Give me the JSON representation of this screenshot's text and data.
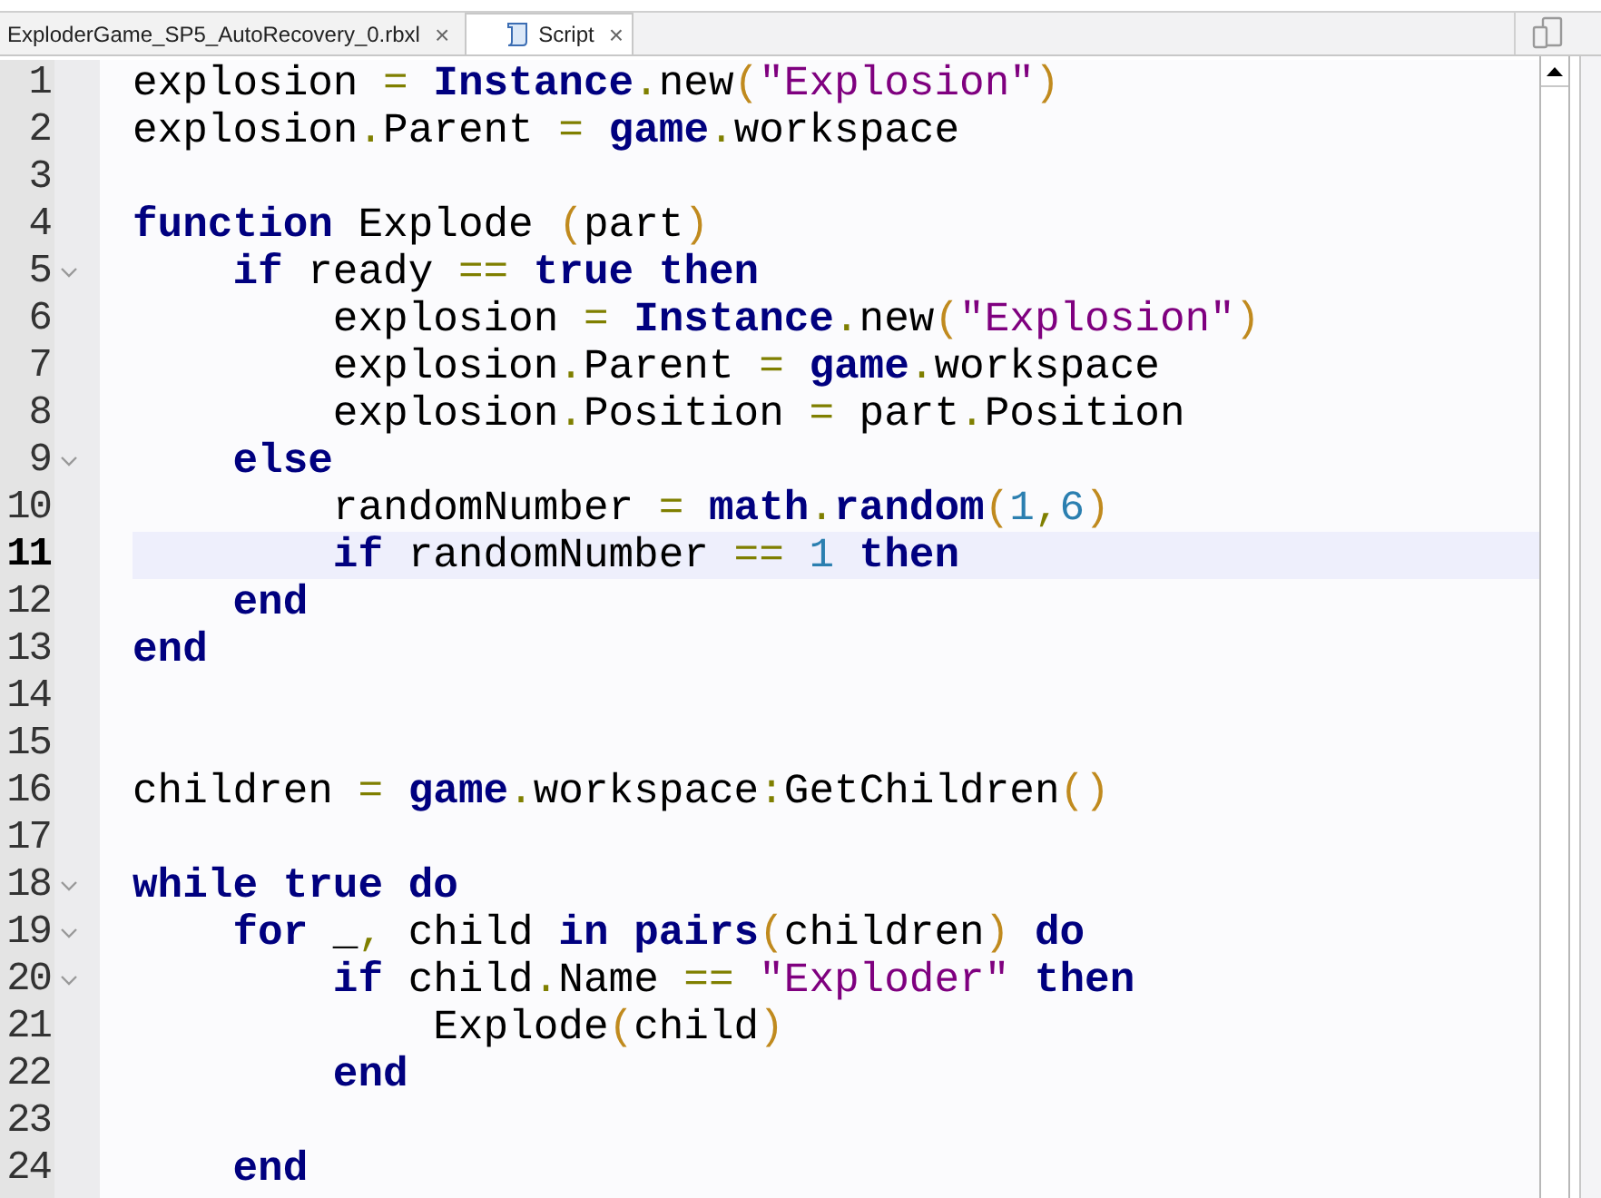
{
  "tabs": [
    {
      "label": "ExploderGame_SP5_AutoRecovery_0.rbxl",
      "selected": false,
      "kind": "place"
    },
    {
      "label": "Script",
      "selected": true,
      "kind": "script"
    }
  ],
  "close_glyph": "×",
  "editor": {
    "lines": [
      {
        "number": "1",
        "fold": false,
        "current": false,
        "tokens": [
          {
            "kind": "plain",
            "text": "explosion "
          },
          {
            "kind": "op",
            "text": "= "
          },
          {
            "kind": "kw",
            "text": "Instance"
          },
          {
            "kind": "op",
            "text": "."
          },
          {
            "kind": "plain",
            "text": "new"
          },
          {
            "kind": "paren",
            "text": "("
          },
          {
            "kind": "str",
            "text": "\"Explosion\""
          },
          {
            "kind": "paren",
            "text": ")"
          }
        ]
      },
      {
        "number": "2",
        "fold": false,
        "current": false,
        "tokens": [
          {
            "kind": "plain",
            "text": "explosion"
          },
          {
            "kind": "op",
            "text": "."
          },
          {
            "kind": "plain",
            "text": "Parent "
          },
          {
            "kind": "op",
            "text": "= "
          },
          {
            "kind": "kw",
            "text": "game"
          },
          {
            "kind": "op",
            "text": "."
          },
          {
            "kind": "plain",
            "text": "workspace"
          }
        ]
      },
      {
        "number": "3",
        "fold": false,
        "current": false
      },
      {
        "number": "4",
        "fold": false,
        "current": false,
        "tokens": [
          {
            "kind": "kw",
            "text": "function "
          },
          {
            "kind": "plain",
            "text": "Explode "
          },
          {
            "kind": "paren",
            "text": "("
          },
          {
            "kind": "plain",
            "text": "part"
          },
          {
            "kind": "paren",
            "text": ")"
          }
        ]
      },
      {
        "number": "5",
        "fold": true,
        "current": false,
        "tokens": [
          {
            "kind": "kw",
            "text": "    if "
          },
          {
            "kind": "plain",
            "text": "ready "
          },
          {
            "kind": "op",
            "text": "== "
          },
          {
            "kind": "kw",
            "text": "true then"
          }
        ]
      },
      {
        "number": "6",
        "fold": false,
        "current": false,
        "tokens": [
          {
            "kind": "plain",
            "text": "        explosion "
          },
          {
            "kind": "op",
            "text": "= "
          },
          {
            "kind": "kw",
            "text": "Instance"
          },
          {
            "kind": "op",
            "text": "."
          },
          {
            "kind": "plain",
            "text": "new"
          },
          {
            "kind": "paren",
            "text": "("
          },
          {
            "kind": "str",
            "text": "\"Explosion\""
          },
          {
            "kind": "paren",
            "text": ")"
          }
        ]
      },
      {
        "number": "7",
        "fold": false,
        "current": false,
        "tokens": [
          {
            "kind": "plain",
            "text": "        explosion"
          },
          {
            "kind": "op",
            "text": "."
          },
          {
            "kind": "plain",
            "text": "Parent "
          },
          {
            "kind": "op",
            "text": "= "
          },
          {
            "kind": "kw",
            "text": "game"
          },
          {
            "kind": "op",
            "text": "."
          },
          {
            "kind": "plain",
            "text": "workspace"
          }
        ]
      },
      {
        "number": "8",
        "fold": false,
        "current": false,
        "tokens": [
          {
            "kind": "plain",
            "text": "        explosion"
          },
          {
            "kind": "op",
            "text": "."
          },
          {
            "kind": "plain",
            "text": "Position "
          },
          {
            "kind": "op",
            "text": "= "
          },
          {
            "kind": "plain",
            "text": "part"
          },
          {
            "kind": "op",
            "text": "."
          },
          {
            "kind": "plain",
            "text": "Position"
          }
        ]
      },
      {
        "number": "9",
        "fold": true,
        "current": false,
        "tokens": [
          {
            "kind": "kw",
            "text": "    else"
          }
        ]
      },
      {
        "number": "10",
        "fold": false,
        "current": false,
        "tokens": [
          {
            "kind": "plain",
            "text": "        randomNumber "
          },
          {
            "kind": "op",
            "text": "= "
          },
          {
            "kind": "kw",
            "text": "math"
          },
          {
            "kind": "op",
            "text": "."
          },
          {
            "kind": "kw",
            "text": "random"
          },
          {
            "kind": "paren",
            "text": "("
          },
          {
            "kind": "num",
            "text": "1"
          },
          {
            "kind": "op",
            "text": ","
          },
          {
            "kind": "num",
            "text": "6"
          },
          {
            "kind": "paren",
            "text": ")"
          }
        ]
      },
      {
        "number": "11",
        "fold": false,
        "current": true,
        "tokens": [
          {
            "kind": "kw",
            "text": "        if "
          },
          {
            "kind": "plain",
            "text": "randomNumber "
          },
          {
            "kind": "op",
            "text": "== "
          },
          {
            "kind": "num",
            "text": "1 "
          },
          {
            "kind": "kw",
            "text": "then"
          }
        ]
      },
      {
        "number": "12",
        "fold": false,
        "current": false,
        "tokens": [
          {
            "kind": "kw",
            "text": "    end"
          }
        ]
      },
      {
        "number": "13",
        "fold": false,
        "current": false,
        "tokens": [
          {
            "kind": "kw",
            "text": "end"
          }
        ]
      },
      {
        "number": "14",
        "fold": false,
        "current": false
      },
      {
        "number": "15",
        "fold": false,
        "current": false
      },
      {
        "number": "16",
        "fold": false,
        "current": false,
        "tokens": [
          {
            "kind": "plain",
            "text": "children "
          },
          {
            "kind": "op",
            "text": "= "
          },
          {
            "kind": "kw",
            "text": "game"
          },
          {
            "kind": "op",
            "text": "."
          },
          {
            "kind": "plain",
            "text": "workspace"
          },
          {
            "kind": "op",
            "text": ":"
          },
          {
            "kind": "plain",
            "text": "GetChildren"
          },
          {
            "kind": "paren",
            "text": "()"
          }
        ]
      },
      {
        "number": "17",
        "fold": false,
        "current": false
      },
      {
        "number": "18",
        "fold": true,
        "current": false,
        "tokens": [
          {
            "kind": "kw",
            "text": "while true do"
          }
        ]
      },
      {
        "number": "19",
        "fold": true,
        "current": false,
        "tokens": [
          {
            "kind": "kw",
            "text": "    for "
          },
          {
            "kind": "plain",
            "text": "_"
          },
          {
            "kind": "op",
            "text": ", "
          },
          {
            "kind": "plain",
            "text": "child "
          },
          {
            "kind": "kw",
            "text": "in pairs"
          },
          {
            "kind": "paren",
            "text": "("
          },
          {
            "kind": "plain",
            "text": "children"
          },
          {
            "kind": "paren",
            "text": ") "
          },
          {
            "kind": "kw",
            "text": "do"
          }
        ]
      },
      {
        "number": "20",
        "fold": true,
        "current": false,
        "tokens": [
          {
            "kind": "kw",
            "text": "        if "
          },
          {
            "kind": "plain",
            "text": "child"
          },
          {
            "kind": "op",
            "text": "."
          },
          {
            "kind": "plain",
            "text": "Name "
          },
          {
            "kind": "op",
            "text": "== "
          },
          {
            "kind": "str",
            "text": "\"Exploder\" "
          },
          {
            "kind": "kw",
            "text": "then"
          }
        ]
      },
      {
        "number": "21",
        "fold": false,
        "current": false,
        "tokens": [
          {
            "kind": "plain",
            "text": "            Explode"
          },
          {
            "kind": "paren",
            "text": "("
          },
          {
            "kind": "plain",
            "text": "child"
          },
          {
            "kind": "paren",
            "text": ")"
          }
        ]
      },
      {
        "number": "22",
        "fold": false,
        "current": false,
        "tokens": [
          {
            "kind": "kw",
            "text": "        end"
          }
        ]
      },
      {
        "number": "23",
        "fold": false,
        "current": false
      },
      {
        "number": "24",
        "fold": false,
        "current": false,
        "tokens": [
          {
            "kind": "kw",
            "text": "    end"
          }
        ]
      }
    ]
  }
}
